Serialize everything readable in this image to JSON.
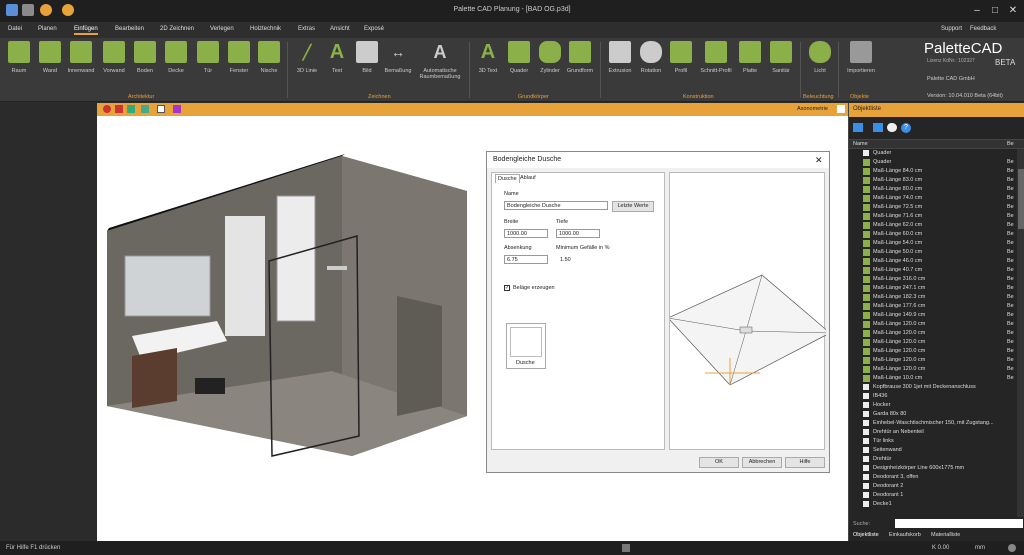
{
  "app": {
    "title": "Palette CAD Planung - [BAD OG.p3d]"
  },
  "menus": [
    "Datei",
    "Planen",
    "Einfügen",
    "Bearbeiten",
    "2D Zeichnen",
    "Verlegen",
    "Holztechnik",
    "Extras",
    "Ansicht",
    "Exposé"
  ],
  "menu_right": {
    "support": "Support",
    "feedback": "Feedback"
  },
  "ribbon": {
    "buttons": [
      {
        "label": "Raum",
        "icon": "room-icon"
      },
      {
        "label": "Wand",
        "icon": "wall-icon"
      },
      {
        "label": "Innenwand",
        "icon": "inner-wall-icon"
      },
      {
        "label": "Vorwand",
        "icon": "pre-wall-icon"
      },
      {
        "label": "Boden",
        "icon": "floor-icon"
      },
      {
        "label": "Decke",
        "icon": "ceiling-icon"
      },
      {
        "label": "Tür",
        "icon": "door-icon"
      },
      {
        "label": "Fenster",
        "icon": "window-icon"
      },
      {
        "label": "Nische",
        "icon": "niche-icon"
      },
      {
        "label": "3D Linie",
        "icon": "line-3d-icon"
      },
      {
        "label": "Text",
        "icon": "text-icon"
      },
      {
        "label": "Bild",
        "icon": "image-icon"
      },
      {
        "label": "Bemaßung",
        "icon": "dimension-icon"
      },
      {
        "label": "Automatische Raumbemaßung",
        "icon": "auto-dimension-icon"
      },
      {
        "label": "3D Text",
        "icon": "text-3d-icon"
      },
      {
        "label": "Quader",
        "icon": "cuboid-icon"
      },
      {
        "label": "Zylinder",
        "icon": "cylinder-icon"
      },
      {
        "label": "Grundform",
        "icon": "basic-shape-icon"
      },
      {
        "label": "Extrusion",
        "icon": "extrusion-icon"
      },
      {
        "label": "Rotation",
        "icon": "rotation-icon"
      },
      {
        "label": "Profil",
        "icon": "profile-icon"
      },
      {
        "label": "Schnitt-Profil",
        "icon": "section-profile-icon"
      },
      {
        "label": "Platte",
        "icon": "plate-icon"
      },
      {
        "label": "Sanitär",
        "icon": "sanitary-icon"
      },
      {
        "label": "Licht",
        "icon": "light-icon"
      },
      {
        "label": "Importieren",
        "icon": "import-icon"
      }
    ],
    "groups": [
      "Architektur",
      "Zeichnen",
      "Grundkörper",
      "Konstruktion",
      "Beleuchtung",
      "Objekte"
    ]
  },
  "brand": {
    "logo": "PaletteCAD",
    "beta": "BETA",
    "license": "Lizenz KdNr.: 102327",
    "company": "Palette CAD GmbH",
    "version": "Version: 10.04.010 Beta (64bit)"
  },
  "view": {
    "mode": "Axonometrie"
  },
  "dialog": {
    "title": "Bodengleiche Dusche",
    "tabs": [
      "Dusche",
      "Ablauf"
    ],
    "name_label": "Name",
    "name_value": "Bodengleiche Dusche",
    "last_values": "Letzte Werte",
    "width_label": "Breite",
    "width_value": "1000.00",
    "depth_label": "Tiefe",
    "depth_value": "1000.00",
    "lower_label": "Absenkung",
    "lower_value": "6.75",
    "slope_label": "Minimum Gefälle in %",
    "slope_value": "1.50",
    "checkbox_label": "Beläge erzeugen",
    "preview_label": "Dusche",
    "ok": "OK",
    "cancel": "Abbrechen",
    "help": "Hilfe"
  },
  "objects": {
    "title": "Objektliste",
    "col_name": "Name",
    "col_be": "Be",
    "items": [
      {
        "text": "Quader",
        "sw": false
      },
      {
        "text": "Quader",
        "sw": true
      },
      {
        "text": "Maß-Länge 84.0 cm",
        "sw": true
      },
      {
        "text": "Maß-Länge 83.0 cm",
        "sw": true
      },
      {
        "text": "Maß-Länge 80.0 cm",
        "sw": true
      },
      {
        "text": "Maß-Länge 74.0 cm",
        "sw": true
      },
      {
        "text": "Maß-Länge 72.5 cm",
        "sw": true
      },
      {
        "text": "Maß-Länge 71.6 cm",
        "sw": true
      },
      {
        "text": "Maß-Länge 62.0 cm",
        "sw": true
      },
      {
        "text": "Maß-Länge 60.0 cm",
        "sw": true
      },
      {
        "text": "Maß-Länge 54.0 cm",
        "sw": true
      },
      {
        "text": "Maß-Länge 50.0 cm",
        "sw": true
      },
      {
        "text": "Maß-Länge 46.0 cm",
        "sw": true
      },
      {
        "text": "Maß-Länge 40.7 cm",
        "sw": true
      },
      {
        "text": "Maß-Länge 316.0 cm",
        "sw": true
      },
      {
        "text": "Maß-Länge 247.1 cm",
        "sw": true
      },
      {
        "text": "Maß-Länge 182.3 cm",
        "sw": true
      },
      {
        "text": "Maß-Länge 177.6 cm",
        "sw": true
      },
      {
        "text": "Maß-Länge 149.9 cm",
        "sw": true
      },
      {
        "text": "Maß-Länge 120.0 cm",
        "sw": true
      },
      {
        "text": "Maß-Länge 120.0 cm",
        "sw": true
      },
      {
        "text": "Maß-Länge 120.0 cm",
        "sw": true
      },
      {
        "text": "Maß-Länge 120.0 cm",
        "sw": true
      },
      {
        "text": "Maß-Länge 120.0 cm",
        "sw": true
      },
      {
        "text": "Maß-Länge 120.0 cm",
        "sw": true
      },
      {
        "text": "Maß-Länge 10.0 cm",
        "sw": true
      },
      {
        "text": "Kopfbrause 300 1jet mit Deckenanschluss",
        "sw": false
      },
      {
        "text": "IB436",
        "sw": false
      },
      {
        "text": "Hocker",
        "sw": false
      },
      {
        "text": "Garda 80x 80",
        "sw": false
      },
      {
        "text": "Einhebel-Waschtischmischer 150, mit Zugstang...",
        "sw": false
      },
      {
        "text": "Drehtür an Nebenteil",
        "sw": false
      },
      {
        "text": "Tür links",
        "sw": false
      },
      {
        "text": "Seitenwand",
        "sw": false
      },
      {
        "text": "Drehtür",
        "sw": false
      },
      {
        "text": "Designheizkörper Line 600x1775 mm",
        "sw": false
      },
      {
        "text": "Deodorant 3, offen",
        "sw": false
      },
      {
        "text": "Deodorant 2",
        "sw": false
      },
      {
        "text": "Deodorant 1",
        "sw": false
      },
      {
        "text": "Decke1",
        "sw": false
      }
    ],
    "search_label": "Suche:",
    "tabs": [
      "Objektliste",
      "Einkaufskorb",
      "Materialliste"
    ]
  },
  "status": {
    "hint": "Für Hilfe F1 drücken",
    "coord": "K 0.00",
    "unit": "mm"
  }
}
